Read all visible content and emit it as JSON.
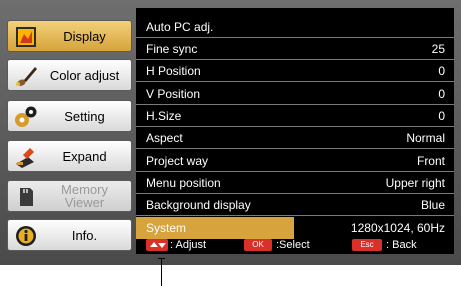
{
  "sidebar": {
    "items": [
      {
        "label": "Display",
        "icon": "display-icon",
        "state": "active"
      },
      {
        "label": "Color adjust",
        "icon": "paint-brush-icon",
        "state": "normal"
      },
      {
        "label": "Setting",
        "icon": "gears-icon",
        "state": "normal"
      },
      {
        "label": "Expand",
        "icon": "expand-tools-icon",
        "state": "normal"
      },
      {
        "label": "Memory Viewer",
        "icon": "memory-card-icon",
        "state": "disabled"
      },
      {
        "label": "Info.",
        "icon": "info-icon",
        "state": "normal"
      }
    ]
  },
  "menu": {
    "rows": [
      {
        "label": "Auto PC adj.",
        "value": ""
      },
      {
        "label": "Fine sync",
        "value": "25"
      },
      {
        "label": "H Position",
        "value": "0"
      },
      {
        "label": "V Position",
        "value": "0"
      },
      {
        "label": "H.Size",
        "value": "0"
      },
      {
        "label": "Aspect",
        "value": "Normal"
      },
      {
        "label": "Project way",
        "value": "Front"
      },
      {
        "label": "Menu position",
        "value": "Upper right"
      },
      {
        "label": "Background display",
        "value": "Blue"
      },
      {
        "label": "System",
        "value": "1280x1024, 60Hz",
        "selected": true
      }
    ]
  },
  "footer": {
    "adjust_icon": "up-down-arrow-icon",
    "adjust_label": ": Adjust",
    "ok_key": "OK",
    "select_label": ":Select",
    "esc_key": "Esc",
    "back_label": ": Back"
  },
  "colors": {
    "highlight": "#d6a33c",
    "panel_bg": "#000000",
    "key_red": "#d9302a"
  }
}
